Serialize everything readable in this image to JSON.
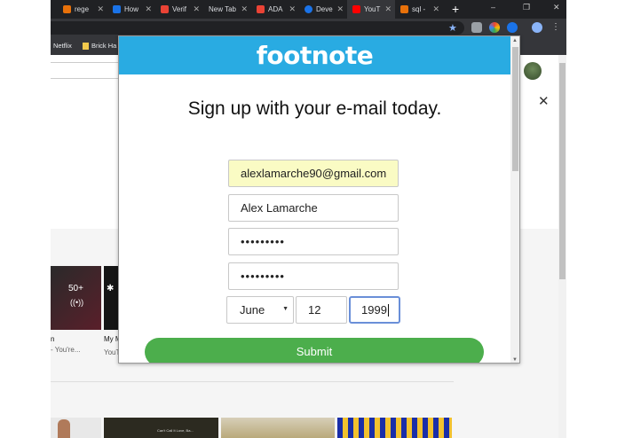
{
  "tabs": [
    {
      "label": "rege",
      "color": "#e8710a"
    },
    {
      "label": "How",
      "color": "#1a73e8"
    },
    {
      "label": "Verif",
      "color": "#ea4335"
    },
    {
      "label": "New Tab",
      "color": ""
    },
    {
      "label": "ADA",
      "color": "#ea4335"
    },
    {
      "label": "Deve",
      "color": "#1a73e8"
    },
    {
      "label": "YouT",
      "color": "#ff0000"
    },
    {
      "label": "sql -",
      "color": "#e8710a"
    }
  ],
  "newtab_label": "+",
  "window_controls": {
    "minimize": "–",
    "restore": "❐",
    "close": "✕"
  },
  "bookmarks": [
    {
      "label": "Netflix"
    },
    {
      "label": "Brick Ha"
    }
  ],
  "background_page": {
    "close_label": "✕",
    "video1_badge": "50+",
    "video1_title": "n",
    "video1_sub": "- You're...",
    "video2_title": "My M",
    "video2_sub": "YouT",
    "thumb_caption": "Can't Call It Love, Ba..."
  },
  "popup": {
    "logo": "footnote",
    "headline": "Sign up with your e-mail today.",
    "email_value": "alexlamarche90@gmail.com",
    "name_value": "Alex Lamarche",
    "password_value": "•••••••••",
    "confirm_value": "•••••••••",
    "month_value": "June",
    "day_value": "12",
    "year_value": "1999",
    "submit_label": "Submit"
  },
  "colors": {
    "header": "#29abe2",
    "submit": "#4cae4c",
    "autofill": "#fafbc4"
  }
}
